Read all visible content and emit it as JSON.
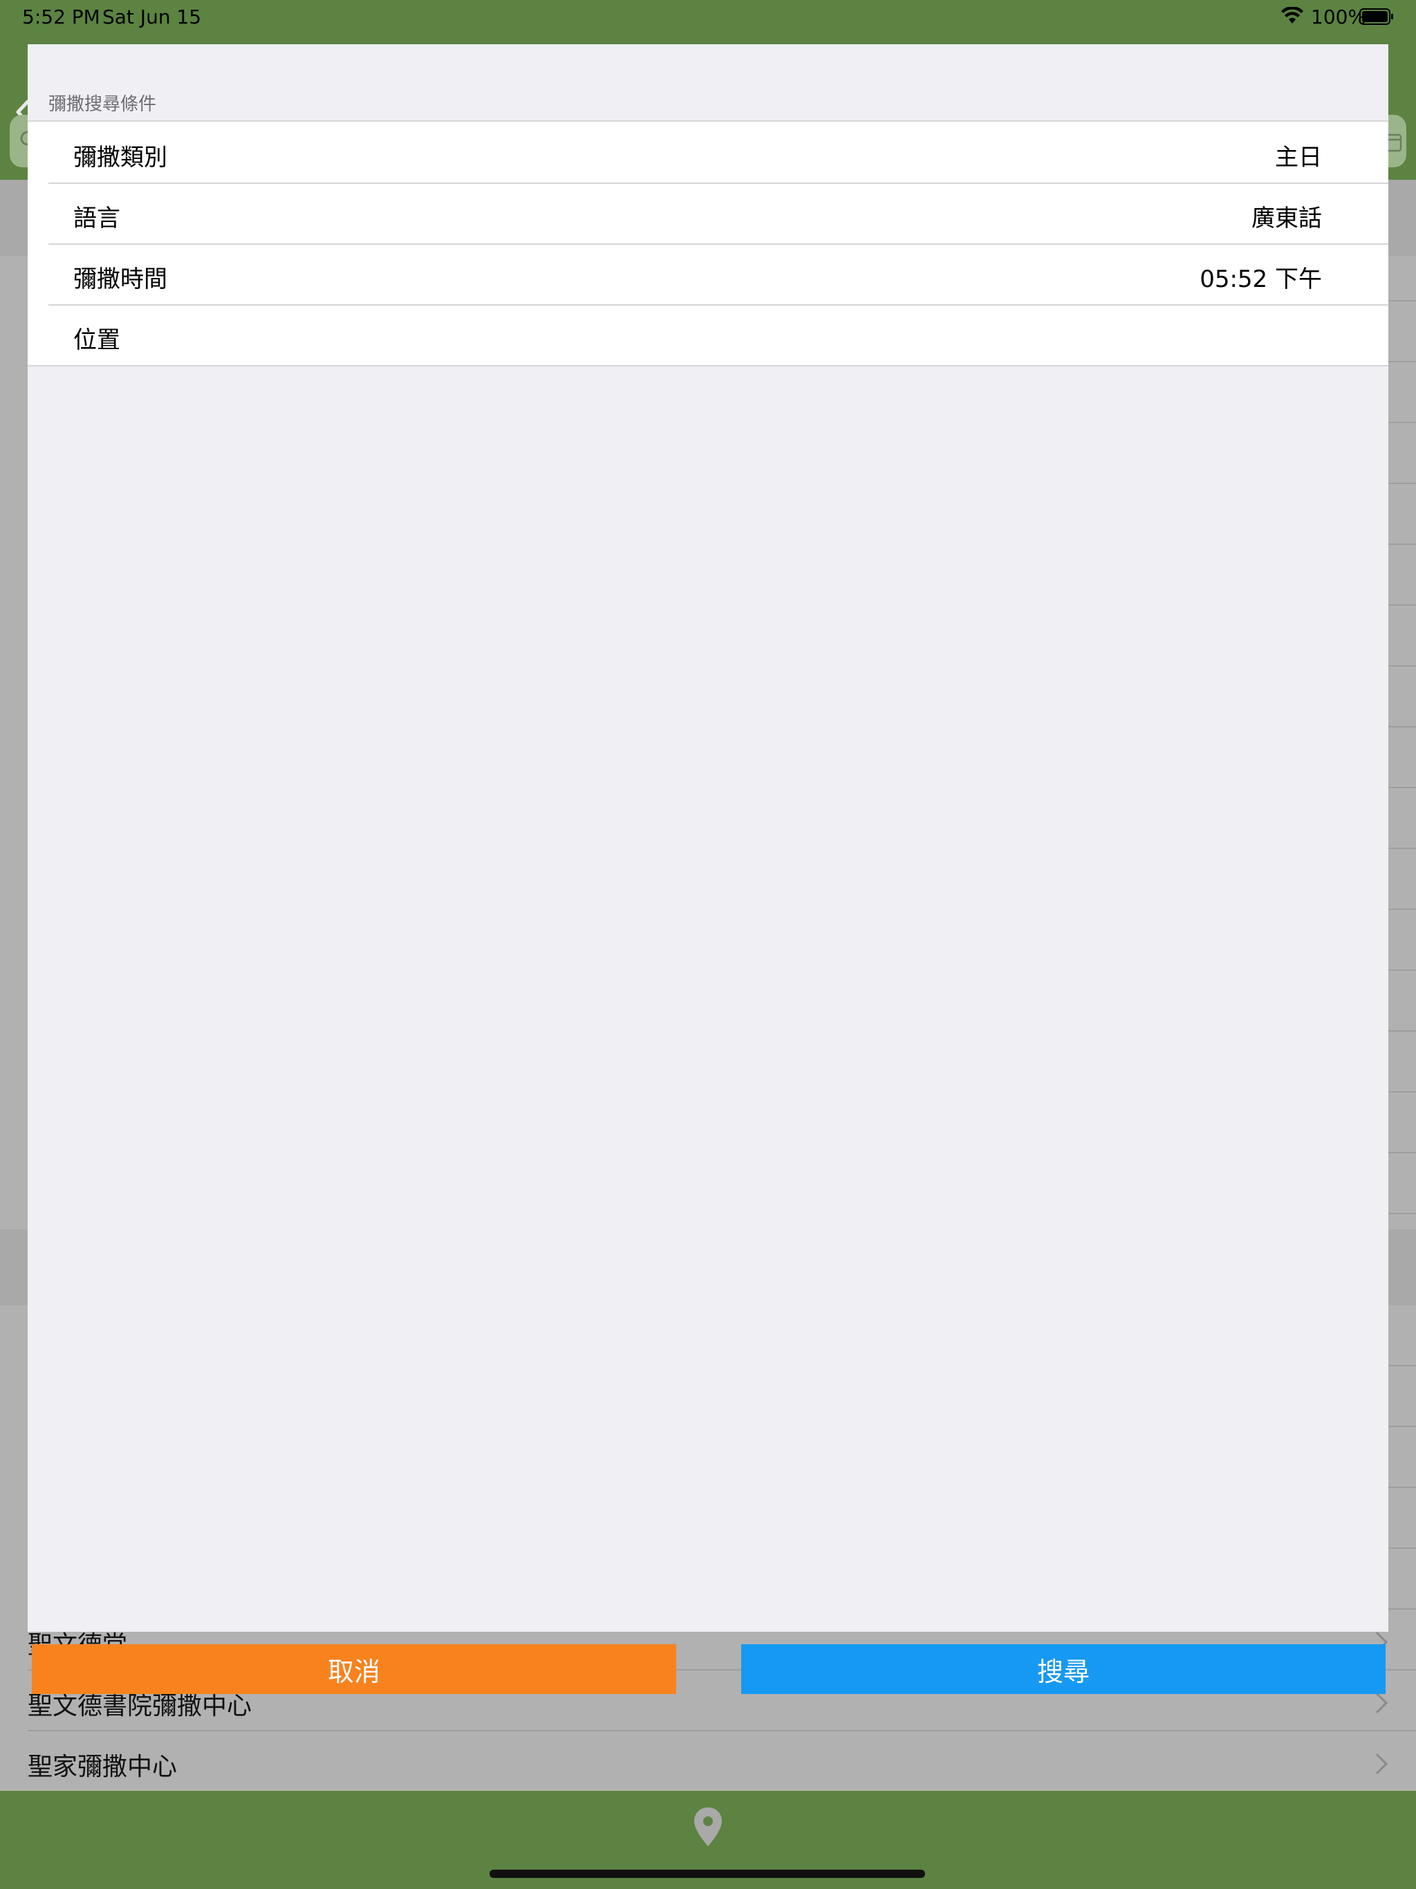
{
  "status_bar": {
    "time": "5:52 PM",
    "date": "Sat Jun 15",
    "battery": "100%"
  },
  "behind_list": {
    "rows": [
      {
        "label": "聖文德堂"
      },
      {
        "label": "聖文德書院彌撒中心"
      },
      {
        "label": "聖家彌撒中心"
      }
    ]
  },
  "modal": {
    "section_header": "彌撒搜尋條件",
    "rows": [
      {
        "label": "彌撒類別",
        "value": "主日"
      },
      {
        "label": "語言",
        "value": "廣東話"
      },
      {
        "label": "彌撒時間",
        "value": "05:52 下午"
      },
      {
        "label": "位置",
        "value": ""
      }
    ],
    "cancel_label": "取消",
    "search_label": "搜尋"
  },
  "colors": {
    "brand_green": "#5c8341",
    "cancel_orange": "#f7821e",
    "search_blue": "#1699f3"
  },
  "icons": {
    "back": "chevron-left-icon",
    "search": "search-icon",
    "status_wifi": "wifi-icon",
    "status_battery": "battery-icon",
    "row_disclosure": "chevron-right-icon",
    "tab_location": "location-pin-icon"
  }
}
